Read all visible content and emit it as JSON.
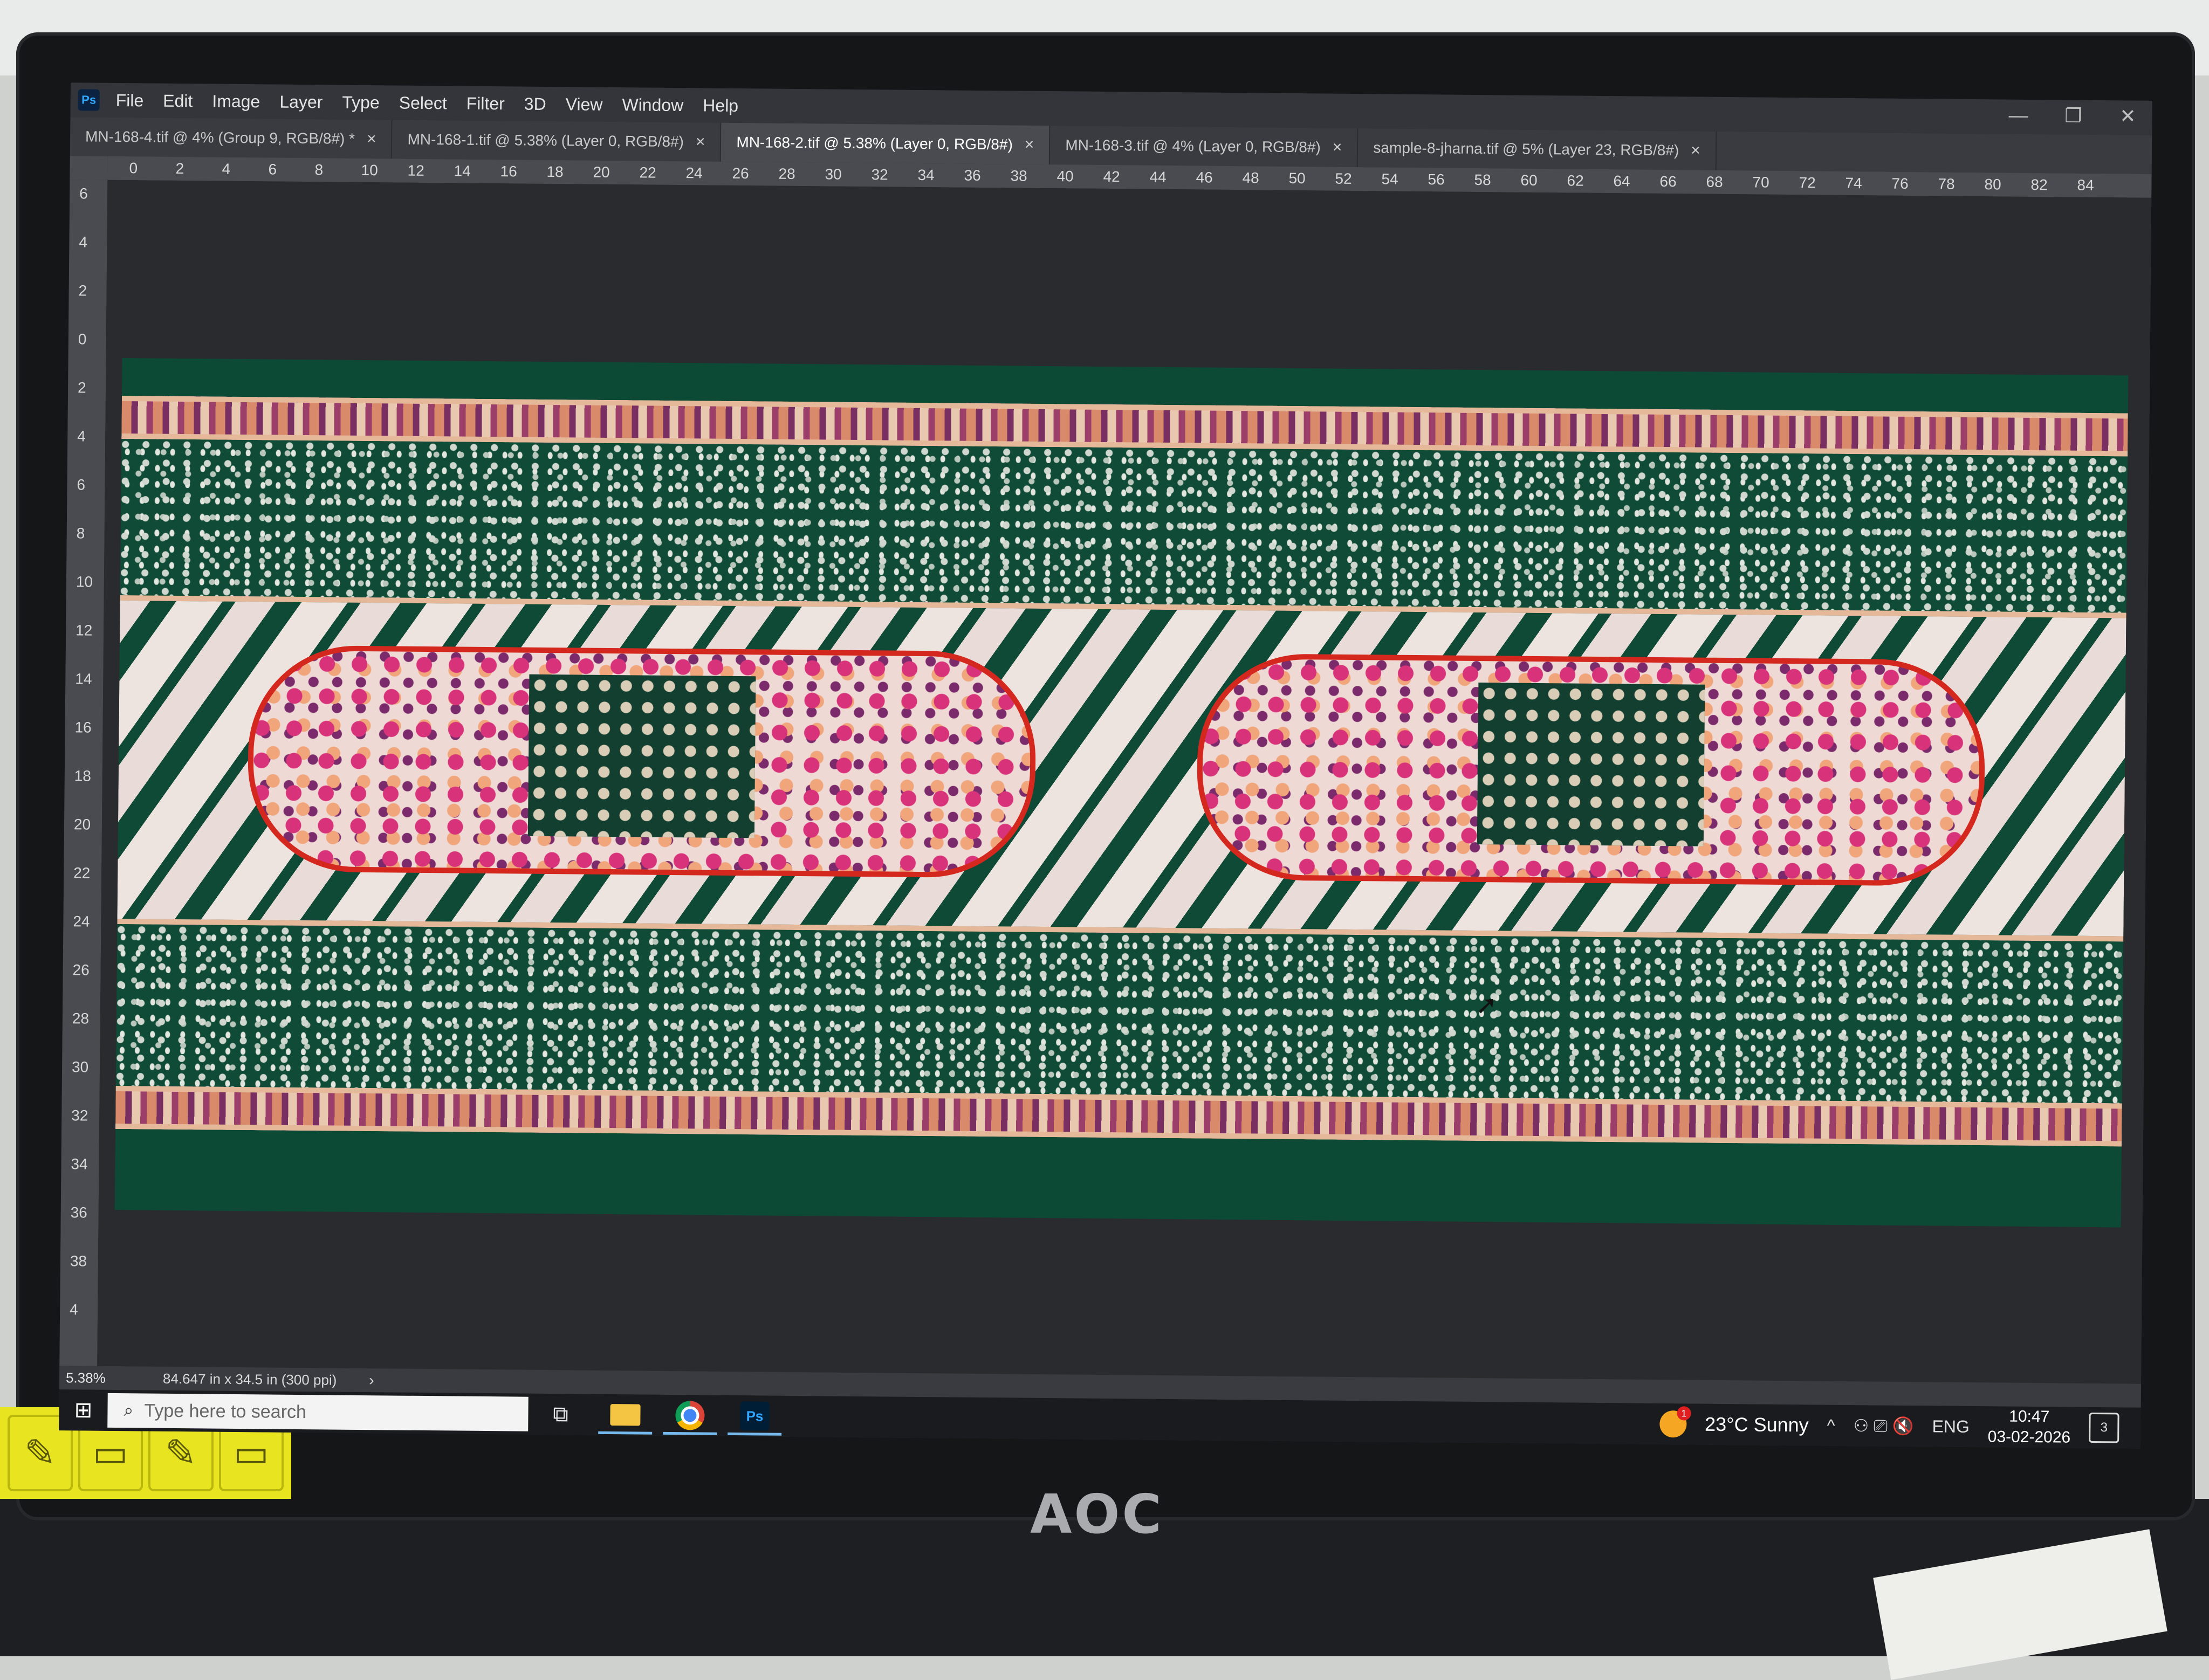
{
  "app": {
    "logo": "Ps"
  },
  "menu": [
    "File",
    "Edit",
    "Image",
    "Layer",
    "Type",
    "Select",
    "Filter",
    "3D",
    "View",
    "Window",
    "Help"
  ],
  "window_controls": {
    "minimize": "—",
    "restore": "❐",
    "close": "✕"
  },
  "tabs": [
    {
      "label": "MN-168-4.tif @ 4% (Group 9, RGB/8#) *",
      "close": "×",
      "active": false
    },
    {
      "label": "MN-168-1.tif @ 5.38% (Layer 0, RGB/8#)",
      "close": "×",
      "active": false
    },
    {
      "label": "MN-168-2.tif @ 5.38% (Layer 0, RGB/8#)",
      "close": "×",
      "active": true
    },
    {
      "label": "MN-168-3.tif @ 4% (Layer 0, RGB/8#)",
      "close": "×",
      "active": false
    },
    {
      "label": "sample-8-jharna.tif @ 5% (Layer 23, RGB/8#)",
      "close": "×",
      "active": false
    }
  ],
  "hruler_ticks": [
    "0",
    "2",
    "4",
    "6",
    "8",
    "10",
    "12",
    "14",
    "16",
    "18",
    "20",
    "22",
    "24",
    "26",
    "28",
    "30",
    "32",
    "34",
    "36",
    "38",
    "40",
    "42",
    "44",
    "46",
    "48",
    "50",
    "52",
    "54",
    "56",
    "58",
    "60",
    "62",
    "64",
    "66",
    "68",
    "70",
    "72",
    "74",
    "76",
    "78",
    "80",
    "82",
    "84"
  ],
  "vruler_ticks": [
    "6",
    "4",
    "2",
    "0",
    "2",
    "4",
    "6",
    "8",
    "10",
    "12",
    "14",
    "16",
    "18",
    "20",
    "22",
    "24",
    "26",
    "28",
    "30",
    "32",
    "34",
    "36",
    "38",
    "4"
  ],
  "status": {
    "zoom": "5.38%",
    "doc_info": "84.647 in x 34.5 in (300 ppi)",
    "arrow": "›"
  },
  "taskbar": {
    "start_icon": "⊞",
    "search_icon": "⌕",
    "search_placeholder": "Type here to search",
    "task_view_icon": "⧉",
    "ps_label": "Ps",
    "weather_badge": "1",
    "weather": "23°C  Sunny",
    "tray_chevron": "^",
    "tray_icons": "⚇ ⎚ 🔇",
    "language": "ENG",
    "time": "10:47",
    "date": "03-02-2026",
    "notif_count": "3"
  },
  "monitor": {
    "brand": "AOC"
  },
  "colors": {
    "fabric_green": "#0d4a35",
    "medallion_red": "#d4281f",
    "ps_blue": "#31a8ff"
  }
}
